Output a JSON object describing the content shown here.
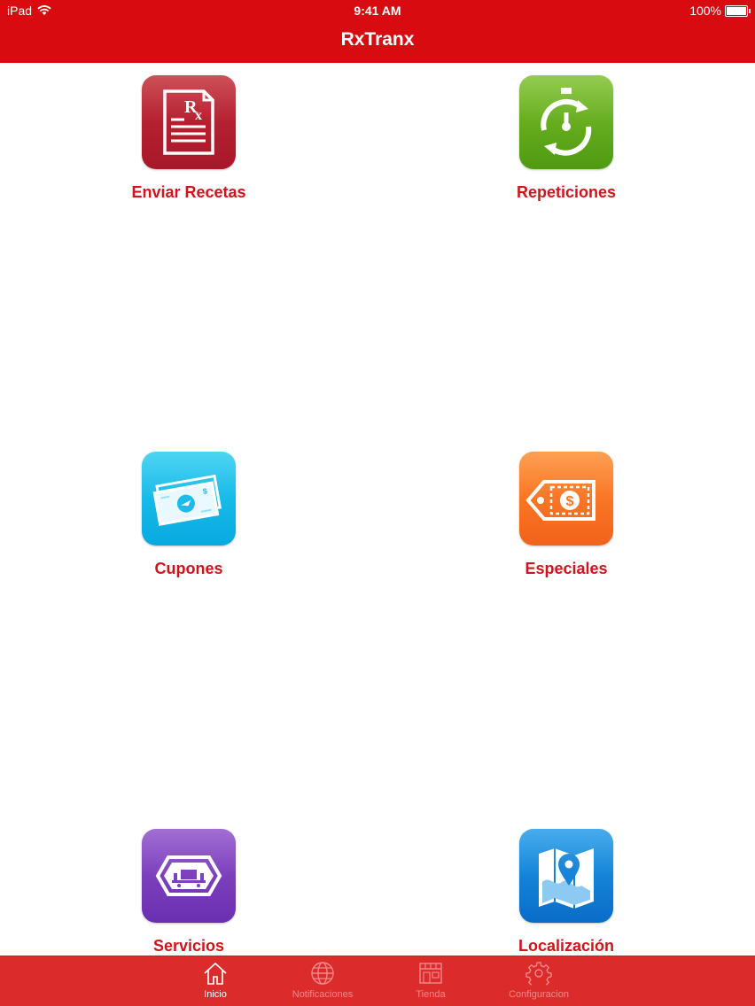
{
  "status_bar": {
    "device": "iPad",
    "time": "9:41 AM",
    "battery": "100%"
  },
  "nav": {
    "title": "RxTranx"
  },
  "tiles": [
    {
      "label": "Enviar Recetas",
      "icon": "prescription-icon",
      "color": "#b51f2f"
    },
    {
      "label": "Repeticiones",
      "icon": "refill-timer-icon",
      "color": "#68ad1e"
    },
    {
      "label": "Cupones",
      "icon": "coupon-icon",
      "color": "#1bbceb"
    },
    {
      "label": "Especiales",
      "icon": "price-tag-icon",
      "color": "#f97624"
    },
    {
      "label": "Servicios",
      "icon": "services-icon",
      "color": "#7c40bd"
    },
    {
      "label": "Localización",
      "icon": "map-pin-icon",
      "color": "#1584d8"
    }
  ],
  "tab_bar": {
    "tabs": [
      {
        "label": "Inicio",
        "icon": "home-icon",
        "active": true
      },
      {
        "label": "Notificaciones",
        "icon": "globe-icon",
        "active": false
      },
      {
        "label": "Tienda",
        "icon": "store-icon",
        "active": false
      },
      {
        "label": "Configuracion",
        "icon": "gear-icon",
        "active": false
      }
    ]
  },
  "colors": {
    "primary_red": "#d80b10",
    "label_red": "#d0141b",
    "tabbar_red": "#dc2b2b"
  }
}
